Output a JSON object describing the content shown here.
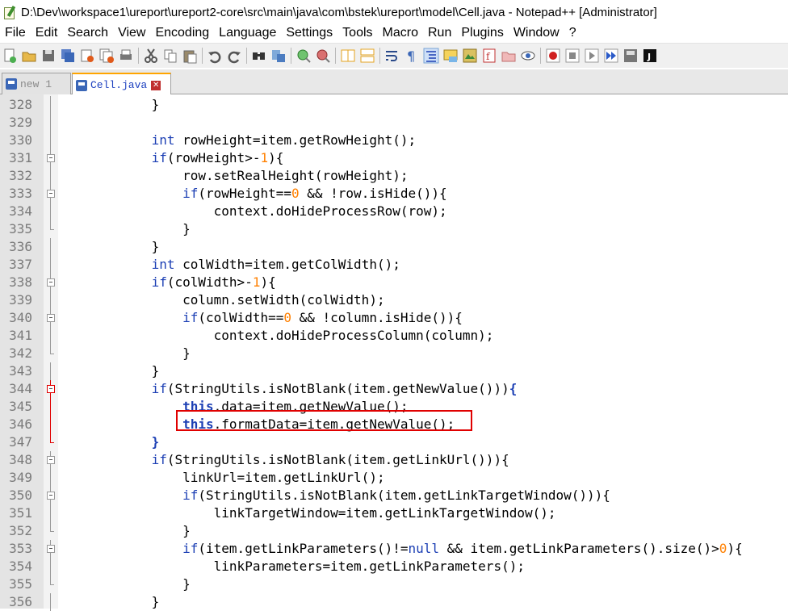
{
  "window": {
    "title": "D:\\Dev\\workspace1\\ureport\\ureport2-core\\src\\main\\java\\com\\bstek\\ureport\\model\\Cell.java - Notepad++ [Administrator]"
  },
  "menu": [
    "File",
    "Edit",
    "Search",
    "View",
    "Encoding",
    "Language",
    "Settings",
    "Tools",
    "Macro",
    "Run",
    "Plugins",
    "Window",
    "?"
  ],
  "toolbar_icons": [
    "new-file-icon",
    "open-file-icon",
    "save-icon",
    "save-all-icon",
    "close-icon",
    "close-all-icon",
    "print-icon",
    "cut-icon",
    "copy-icon",
    "paste-icon",
    "undo-icon",
    "redo-icon",
    "find-icon",
    "replace-icon",
    "zoom-in-icon",
    "zoom-out-icon",
    "sync-vertical-icon",
    "sync-horizontal-icon",
    "word-wrap-icon",
    "show-all-chars-icon",
    "indent-guide-icon",
    "user-defined-lang-icon",
    "doc-map-icon",
    "function-list-icon",
    "folder-workspace-icon",
    "monitoring-icon",
    "record-macro-icon",
    "stop-macro-icon",
    "play-macro-icon",
    "run-macro-multiple-icon",
    "save-macro-icon",
    "plugin-j-icon"
  ],
  "tabs": [
    {
      "label": "new 1",
      "active": false
    },
    {
      "label": "Cell.java",
      "active": true
    }
  ],
  "editor": {
    "lines": [
      {
        "n": "328",
        "text": "            }"
      },
      {
        "n": "329",
        "text": ""
      },
      {
        "n": "330",
        "text": "            int rowHeight=item.getRowHeight();"
      },
      {
        "n": "331",
        "text": "            if(rowHeight>-1){"
      },
      {
        "n": "332",
        "text": "                row.setRealHeight(rowHeight);"
      },
      {
        "n": "333",
        "text": "                if(rowHeight==0 && !row.isHide()){"
      },
      {
        "n": "334",
        "text": "                    context.doHideProcessRow(row);"
      },
      {
        "n": "335",
        "text": "                }"
      },
      {
        "n": "336",
        "text": "            }"
      },
      {
        "n": "337",
        "text": "            int colWidth=item.getColWidth();"
      },
      {
        "n": "338",
        "text": "            if(colWidth>-1){"
      },
      {
        "n": "339",
        "text": "                column.setWidth(colWidth);"
      },
      {
        "n": "340",
        "text": "                if(colWidth==0 && !column.isHide()){"
      },
      {
        "n": "341",
        "text": "                    context.doHideProcessColumn(column);"
      },
      {
        "n": "342",
        "text": "                }"
      },
      {
        "n": "343",
        "text": "            }"
      },
      {
        "n": "344",
        "text": "            if(StringUtils.isNotBlank(item.getNewValue())){"
      },
      {
        "n": "345",
        "text": "                this.data=item.getNewValue();"
      },
      {
        "n": "346",
        "text": "                this.formatData=item.getNewValue();"
      },
      {
        "n": "347",
        "text": "            }"
      },
      {
        "n": "348",
        "text": "            if(StringUtils.isNotBlank(item.getLinkUrl())){"
      },
      {
        "n": "349",
        "text": "                linkUrl=item.getLinkUrl();"
      },
      {
        "n": "350",
        "text": "                if(StringUtils.isNotBlank(item.getLinkTargetWindow())){"
      },
      {
        "n": "351",
        "text": "                    linkTargetWindow=item.getLinkTargetWindow();"
      },
      {
        "n": "352",
        "text": "                }"
      },
      {
        "n": "353",
        "text": "                if(item.getLinkParameters()!=null && item.getLinkParameters().size()>0){"
      },
      {
        "n": "354",
        "text": "                    linkParameters=item.getLinkParameters();"
      },
      {
        "n": "355",
        "text": "                }"
      },
      {
        "n": "356",
        "text": "            }"
      }
    ]
  },
  "colors": {
    "keyword": "#1c3fb4",
    "number": "#ff8000",
    "highlight_box": "#e00000",
    "active_tab_accent": "#ffa500"
  }
}
